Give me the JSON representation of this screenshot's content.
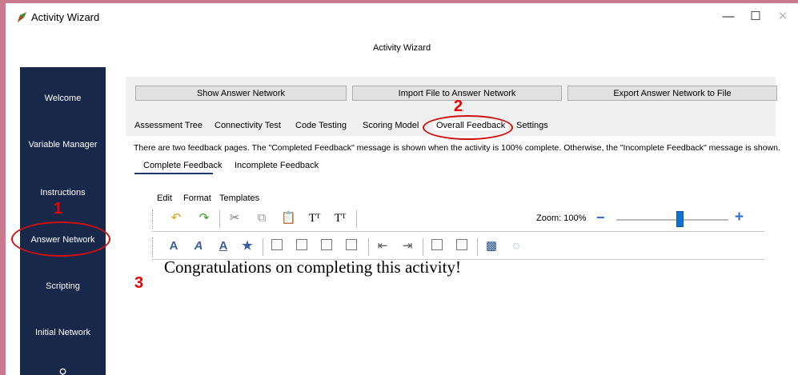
{
  "window": {
    "title": "Activity Wizard",
    "subtitle": "Activity Wizard"
  },
  "window_controls": {
    "minimize": "—",
    "maximize": "☐",
    "close": "✕"
  },
  "sidebar": {
    "items": [
      {
        "label": "Welcome"
      },
      {
        "label": "Variable Manager"
      },
      {
        "label": "Instructions"
      },
      {
        "label": "Answer Network"
      },
      {
        "label": "Scripting"
      },
      {
        "label": "Initial Network"
      }
    ]
  },
  "top_buttons": {
    "show": "Show Answer Network",
    "import": "Import File to Answer Network",
    "export": "Export Answer Network to File"
  },
  "tabs": [
    {
      "label": "Assessment Tree"
    },
    {
      "label": "Connectivity Test"
    },
    {
      "label": "Code Testing"
    },
    {
      "label": "Scoring Model"
    },
    {
      "label": "Overall Feedback"
    },
    {
      "label": "Settings"
    }
  ],
  "info_text": "There are two feedback pages. The \"Completed Feedback\" message is shown when the activity is 100% complete. Otherwise, the \"Incomplete Feedback\" message is shown.",
  "subtabs": [
    {
      "label": "Complete Feedback"
    },
    {
      "label": "Incomplete Feedback"
    }
  ],
  "menu": {
    "edit": "Edit",
    "format": "Format",
    "templates": "Templates"
  },
  "zoom": {
    "label": "Zoom: 100%",
    "value_percent": 100,
    "minus": "−",
    "plus": "+"
  },
  "editor": {
    "text": "Congratulations on completing this activity!"
  },
  "annotations": {
    "one": "1",
    "two": "2",
    "three": "3",
    "color": "#e00000"
  }
}
